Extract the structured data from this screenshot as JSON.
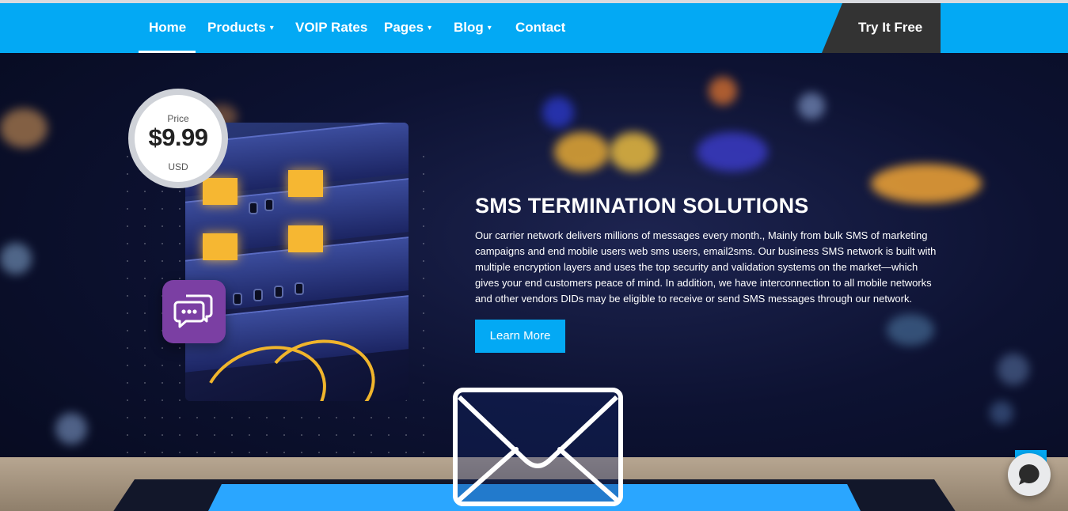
{
  "nav": {
    "items": [
      {
        "label": "Home",
        "has_dropdown": false,
        "active": true
      },
      {
        "label": "Products",
        "has_dropdown": true
      },
      {
        "label": "VOIP Rates",
        "has_dropdown": false
      },
      {
        "label": "Pages",
        "has_dropdown": true
      },
      {
        "label": "Blog",
        "has_dropdown": true
      },
      {
        "label": "Contact",
        "has_dropdown": false
      }
    ],
    "caret": "▾",
    "cta_label": "Try It Free"
  },
  "price": {
    "label": "Price",
    "value": "$9.99",
    "currency": "USD"
  },
  "hero": {
    "title": "SMS TERMINATION SOLUTIONS",
    "description": "Our carrier network delivers millions of messages every month., Mainly from bulk SMS of marketing campaigns and end mobile users web sms users, email2sms. Our business SMS network is built with multiple encryption layers and uses the top security and validation systems on the market—which gives your end customers peace of mind. In addition, we have interconnection to all mobile networks and other vendors DIDs may be eligible to receive or send SMS messages through our network.",
    "button_label": "Learn More"
  },
  "icons": {
    "chat_bubbles": "chat-bubbles-icon",
    "envelope": "envelope-icon",
    "live_chat": "live-chat-icon"
  },
  "colors": {
    "primary": "#03a9f4",
    "cta_bg": "#333333",
    "chat_icon_bg": "#7b3fa3"
  }
}
